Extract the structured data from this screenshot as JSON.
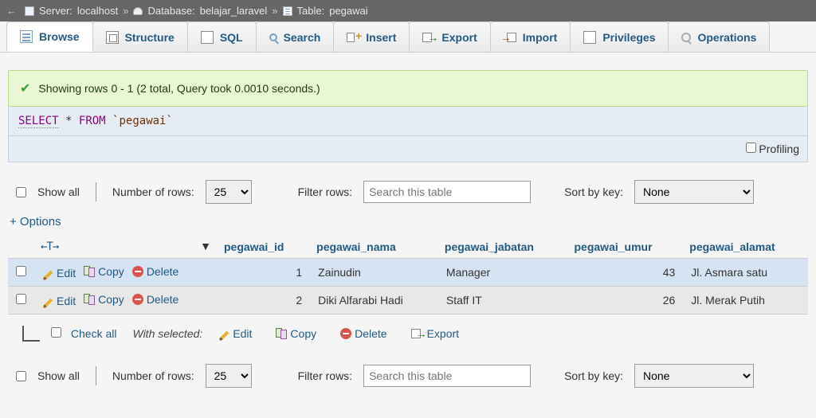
{
  "breadcrumb": {
    "server_label": "Server:",
    "server_value": "localhost",
    "database_label": "Database:",
    "database_value": "belajar_laravel",
    "table_label": "Table:",
    "table_value": "pegawai",
    "sep": "»"
  },
  "tabs": [
    {
      "label": "Browse",
      "name": "browse"
    },
    {
      "label": "Structure",
      "name": "structure"
    },
    {
      "label": "SQL",
      "name": "sql"
    },
    {
      "label": "Search",
      "name": "search"
    },
    {
      "label": "Insert",
      "name": "insert"
    },
    {
      "label": "Export",
      "name": "export"
    },
    {
      "label": "Import",
      "name": "import"
    },
    {
      "label": "Privileges",
      "name": "privileges"
    },
    {
      "label": "Operations",
      "name": "operations"
    }
  ],
  "success": {
    "text": "Showing rows 0 - 1 (2 total, Query took 0.0010 seconds.)"
  },
  "sql": {
    "select": "SELECT",
    "star": "*",
    "from": "FROM",
    "table": "`pegawai`"
  },
  "profiling_label": "Profiling",
  "filter": {
    "show_all_label": "Show all",
    "num_rows_label": "Number of rows:",
    "num_rows_value": "25",
    "filter_label": "Filter rows:",
    "filter_placeholder": "Search this table",
    "sort_label": "Sort by key:",
    "sort_value": "None"
  },
  "options_link": "+ Options",
  "table": {
    "sort_icons": "←T→",
    "down_triangle": "▼",
    "columns": [
      "pegawai_id",
      "pegawai_nama",
      "pegawai_jabatan",
      "pegawai_umur",
      "pegawai_alamat"
    ],
    "actions": {
      "edit": "Edit",
      "copy": "Copy",
      "delete": "Delete"
    },
    "rows": [
      {
        "id": 1,
        "nama": "Zainudin",
        "jabatan": "Manager",
        "umur": 43,
        "alamat": "Jl. Asmara satu"
      },
      {
        "id": 2,
        "nama": "Diki Alfarabi Hadi",
        "jabatan": "Staff IT",
        "umur": 26,
        "alamat": "Jl. Merak Putih"
      }
    ]
  },
  "with_selected": {
    "check_all": "Check all",
    "label": "With selected:",
    "edit": "Edit",
    "copy": "Copy",
    "delete": "Delete",
    "export": "Export"
  }
}
